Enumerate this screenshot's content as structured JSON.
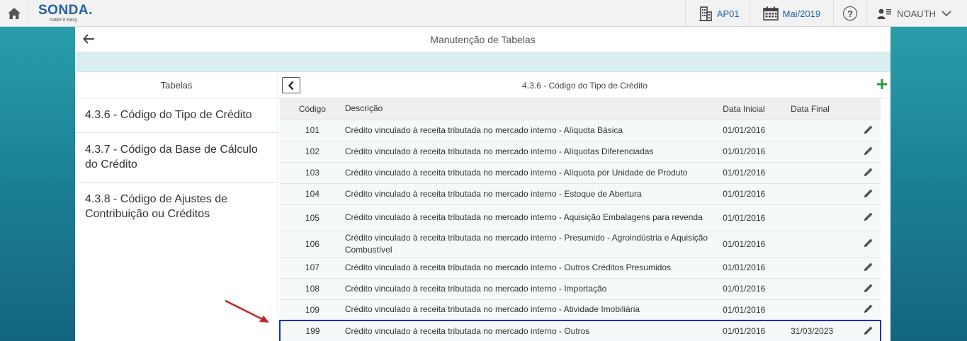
{
  "topbar": {
    "logo": "SONDA.",
    "logo_tagline": "make it easy",
    "company": "AP01",
    "period": "Mai/2019",
    "help": "?",
    "user": "NOAUTH"
  },
  "page": {
    "title": "Manutenção de Tabelas"
  },
  "tables_panel": {
    "header": "Tabelas",
    "items": [
      "4.3.6 - Código do Tipo de Crédito",
      "4.3.7 - Código da Base de Cálculo do Crédito",
      "4.3.8 - Código de Ajustes de Contribuição ou Créditos"
    ]
  },
  "detail": {
    "title": "4.3.6 - Código do Tipo de Crédito",
    "columns": {
      "code": "Código",
      "description": "Descrição",
      "start": "Data Inicial",
      "end": "Data Final"
    },
    "rows": [
      {
        "code": "101",
        "description": "Crédito vinculado à receita tributada no mercado interno - Alíquota Básica",
        "start": "01/01/2016",
        "end": ""
      },
      {
        "code": "102",
        "description": "Crédito vinculado à receita tributada no mercado interno - Alíquotas Diferenciadas",
        "start": "01/01/2016",
        "end": ""
      },
      {
        "code": "103",
        "description": "Crédito vinculado à receita tributada no mercado interno - Alíquota por Unidade de Produto",
        "start": "01/01/2016",
        "end": ""
      },
      {
        "code": "104",
        "description": "Crédito vinculado à receita tributada no mercado interno - Estoque de Abertura",
        "start": "01/01/2016",
        "end": ""
      },
      {
        "code": "105",
        "description": "Crédito vinculado à receita tributada no mercado interno - Aquisição Embalagens para revenda",
        "start": "01/01/2016",
        "end": ""
      },
      {
        "code": "106",
        "description": "Crédito vinculado à receita tributada no mercado interno - Presumido - Agroindústria e Aquisição Combustível",
        "start": "01/01/2016",
        "end": ""
      },
      {
        "code": "107",
        "description": "Crédito vinculado à receita tributada no mercado interno - Outros Créditos Presumidos",
        "start": "01/01/2016",
        "end": ""
      },
      {
        "code": "108",
        "description": "Crédito vinculado à receita tributada no mercado interno - Importação",
        "start": "01/01/2016",
        "end": ""
      },
      {
        "code": "109",
        "description": "Crédito vinculado à receita tributada no mercado interno - Atividade Imobiliária",
        "start": "01/01/2016",
        "end": ""
      },
      {
        "code": "199",
        "description": "Crédito vinculado à receita tributada no mercado interno - Outros",
        "start": "01/01/2016",
        "end": "31/03/2023"
      }
    ]
  },
  "colors": {
    "brand": "#1f5fa8",
    "selection": "#1a2fc8",
    "add": "#2e9a3a",
    "annotation_arrow": "#c0272d"
  },
  "icons": {
    "home": "home-icon",
    "company": "building-icon",
    "period": "calendar-icon",
    "help": "help-icon",
    "user": "user-icon",
    "dropdown": "chevron-down-icon",
    "back": "arrow-left-icon",
    "prev": "chevron-left-icon",
    "add": "plus-icon",
    "edit": "pencil-icon"
  }
}
